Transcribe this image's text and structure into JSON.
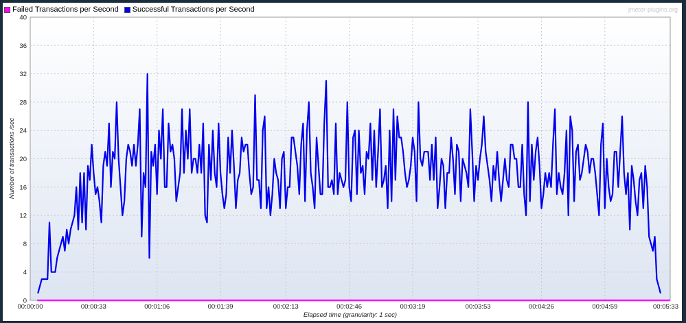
{
  "legend": {
    "failed_label": "Failed Transactions per Second",
    "success_label": "Successful Transactions per Second"
  },
  "watermark": "jmeter-plugins.org",
  "colors": {
    "failed": "#ff00ff",
    "success": "#0000ee",
    "plot_top": "#ffffff",
    "plot_bottom": "#dde5f2",
    "grid": "#c8c8c8"
  },
  "chart_data": {
    "type": "line",
    "title": "",
    "xlabel": "Elapsed time (granularity: 1 sec)",
    "ylabel": "Number of transactions /sec",
    "ylim": [
      0,
      40
    ],
    "xlim_seconds": [
      0,
      333
    ],
    "grid": true,
    "legend_position": "top-left",
    "y_ticks": [
      "0",
      "4",
      "8",
      "12",
      "16",
      "20",
      "24",
      "28",
      "32",
      "36",
      "40"
    ],
    "x_ticks": [
      "00:00:00",
      "00:00:33",
      "00:01:06",
      "00:01:39",
      "00:02:13",
      "00:02:46",
      "00:03:19",
      "00:03:53",
      "00:04:26",
      "00:04:59",
      "00:05:33"
    ],
    "x": [
      "00:00:04",
      "00:00:05",
      "00:00:06",
      "00:00:07",
      "00:00:08",
      "00:00:09",
      "00:00:10",
      "00:00:11",
      "00:00:12",
      "00:00:13",
      "00:00:14",
      "00:00:15",
      "00:00:16",
      "00:00:17",
      "00:00:18",
      "00:00:19",
      "00:00:20",
      "00:00:21",
      "00:00:22",
      "00:00:23",
      "00:00:24",
      "00:00:25",
      "00:00:26",
      "00:00:27",
      "00:00:28",
      "00:00:29",
      "00:00:30",
      "00:00:31",
      "00:00:32",
      "00:00:33",
      "00:00:34",
      "00:00:35",
      "00:00:36",
      "00:00:37",
      "00:00:38",
      "00:00:39",
      "00:00:40",
      "00:00:41",
      "00:00:42",
      "00:00:43",
      "00:00:44",
      "00:00:45",
      "00:00:46",
      "00:00:47",
      "00:00:48",
      "00:00:49",
      "00:00:50",
      "00:00:51",
      "00:00:52",
      "00:00:53",
      "00:00:54",
      "00:00:55",
      "00:00:56",
      "00:00:57",
      "00:00:58",
      "00:00:59",
      "00:01:00",
      "00:01:01",
      "00:01:02",
      "00:01:03",
      "00:01:04",
      "00:01:05",
      "00:01:06",
      "00:01:07",
      "00:01:08",
      "00:01:09",
      "00:01:10",
      "00:01:11",
      "00:01:12",
      "00:01:13",
      "00:01:14",
      "00:01:15",
      "00:01:16",
      "00:01:17",
      "00:01:18",
      "00:01:19",
      "00:01:20",
      "00:01:21",
      "00:01:22",
      "00:01:23",
      "00:01:24",
      "00:01:25",
      "00:01:26",
      "00:01:27",
      "00:01:28",
      "00:01:29",
      "00:01:30",
      "00:01:31",
      "00:01:32",
      "00:01:33",
      "00:01:34",
      "00:01:35",
      "00:01:36",
      "00:01:37",
      "00:01:38",
      "00:01:39",
      "00:01:40",
      "00:01:41",
      "00:01:42",
      "00:01:43",
      "00:01:44",
      "00:01:45",
      "00:01:46",
      "00:01:47",
      "00:01:48",
      "00:01:49",
      "00:01:50",
      "00:01:51",
      "00:01:52",
      "00:01:53",
      "00:01:54",
      "00:01:55",
      "00:01:56",
      "00:01:57",
      "00:01:58",
      "00:01:59",
      "00:02:00",
      "00:02:01",
      "00:02:02",
      "00:02:03",
      "00:02:04",
      "00:02:05",
      "00:02:06",
      "00:02:07",
      "00:02:08",
      "00:02:09",
      "00:02:10",
      "00:02:11",
      "00:02:12",
      "00:02:13",
      "00:02:14",
      "00:02:15",
      "00:02:16",
      "00:02:17",
      "00:02:18",
      "00:02:19",
      "00:02:20",
      "00:02:21",
      "00:02:22",
      "00:02:23",
      "00:02:24",
      "00:02:25",
      "00:02:26",
      "00:02:27",
      "00:02:28",
      "00:02:29",
      "00:02:30",
      "00:02:31",
      "00:02:32",
      "00:02:33",
      "00:02:34",
      "00:02:35",
      "00:02:36",
      "00:02:37",
      "00:02:38",
      "00:02:39",
      "00:02:40",
      "00:02:41",
      "00:02:42",
      "00:02:43",
      "00:02:44",
      "00:02:45",
      "00:02:46",
      "00:02:47",
      "00:02:48",
      "00:02:49",
      "00:02:50",
      "00:02:51",
      "00:02:52",
      "00:02:53",
      "00:02:54",
      "00:02:55",
      "00:02:56",
      "00:02:57",
      "00:02:58",
      "00:02:59",
      "00:03:00",
      "00:03:01",
      "00:03:02",
      "00:03:03",
      "00:03:04",
      "00:03:05",
      "00:03:06",
      "00:03:07",
      "00:03:08",
      "00:03:09",
      "00:03:10",
      "00:03:11",
      "00:03:12",
      "00:03:13",
      "00:03:14",
      "00:03:15",
      "00:03:16",
      "00:03:17",
      "00:03:18",
      "00:03:19",
      "00:03:20",
      "00:03:21",
      "00:03:22",
      "00:03:23",
      "00:03:24",
      "00:03:25",
      "00:03:26",
      "00:03:27",
      "00:03:28",
      "00:03:29",
      "00:03:30",
      "00:03:31",
      "00:03:32",
      "00:03:33",
      "00:03:34",
      "00:03:35",
      "00:03:36",
      "00:03:37",
      "00:03:38",
      "00:03:39",
      "00:03:40",
      "00:03:41",
      "00:03:42",
      "00:03:43",
      "00:03:44",
      "00:03:45",
      "00:03:46",
      "00:03:47",
      "00:03:48",
      "00:03:49",
      "00:03:50",
      "00:03:51",
      "00:03:52",
      "00:03:53",
      "00:03:54",
      "00:03:55",
      "00:03:56",
      "00:03:57",
      "00:03:58",
      "00:03:59",
      "00:04:00",
      "00:04:01",
      "00:04:02",
      "00:04:03",
      "00:04:04",
      "00:04:05",
      "00:04:06",
      "00:04:07",
      "00:04:08",
      "00:04:09",
      "00:04:10",
      "00:04:11",
      "00:04:12",
      "00:04:13",
      "00:04:14",
      "00:04:15",
      "00:04:16",
      "00:04:17",
      "00:04:18",
      "00:04:19",
      "00:04:20",
      "00:04:21",
      "00:04:22",
      "00:04:23",
      "00:04:24",
      "00:04:25",
      "00:04:26",
      "00:04:27",
      "00:04:28",
      "00:04:29",
      "00:04:30",
      "00:04:31",
      "00:04:32",
      "00:04:33",
      "00:04:34",
      "00:04:35",
      "00:04:36",
      "00:04:37",
      "00:04:38",
      "00:04:39",
      "00:04:40",
      "00:04:41",
      "00:04:42",
      "00:04:43",
      "00:04:44",
      "00:04:45",
      "00:04:46",
      "00:04:47",
      "00:04:48",
      "00:04:49",
      "00:04:50",
      "00:04:51",
      "00:04:52",
      "00:04:53",
      "00:04:54",
      "00:04:55",
      "00:04:56",
      "00:04:57",
      "00:04:58",
      "00:04:59",
      "00:05:00",
      "00:05:01",
      "00:05:02",
      "00:05:03",
      "00:05:04",
      "00:05:05",
      "00:05:06",
      "00:05:07",
      "00:05:08",
      "00:05:09",
      "00:05:10",
      "00:05:11",
      "00:05:12",
      "00:05:13",
      "00:05:14",
      "00:05:15",
      "00:05:16",
      "00:05:17",
      "00:05:18",
      "00:05:19",
      "00:05:20",
      "00:05:21",
      "00:05:22",
      "00:05:23",
      "00:05:24",
      "00:05:25",
      "00:05:26",
      "00:05:27",
      "00:05:28",
      "00:05:29",
      "00:05:30",
      "00:05:31",
      "00:05:32",
      "00:05:33"
    ],
    "series": [
      {
        "name": "Successful Transactions per Second",
        "values": [
          1,
          2,
          3,
          3,
          3,
          3,
          11,
          4,
          4,
          4,
          6,
          7,
          8,
          9,
          7,
          10,
          8,
          10,
          11,
          12,
          16,
          10,
          18,
          11,
          18,
          10,
          19,
          17,
          22,
          18,
          15,
          16,
          14,
          11,
          19,
          21,
          19,
          25,
          16,
          21,
          20,
          28,
          20,
          16,
          12,
          14,
          20,
          22,
          21,
          19,
          22,
          19,
          22,
          27,
          9,
          18,
          16,
          32,
          6,
          21,
          19,
          22,
          15,
          24,
          20,
          27,
          16,
          16,
          25,
          21,
          22,
          20,
          14,
          16,
          18,
          27,
          18,
          24,
          20,
          27,
          18,
          20,
          20,
          18,
          22,
          18,
          25,
          12,
          11,
          22,
          17,
          24,
          18,
          16,
          25,
          18,
          15,
          13,
          15,
          23,
          18,
          24,
          19,
          13,
          17,
          18,
          23,
          21,
          22,
          22,
          18,
          15,
          16,
          29,
          17,
          17,
          13,
          24,
          26,
          13,
          16,
          12,
          15,
          20,
          18,
          17,
          13,
          20,
          21,
          13,
          16,
          16,
          23,
          23,
          21,
          19,
          15,
          22,
          25,
          14,
          24,
          28,
          18,
          16,
          13,
          23,
          19,
          15,
          15,
          25,
          31,
          16,
          16,
          17,
          15,
          25,
          15,
          18,
          17,
          16,
          17,
          28,
          16,
          14,
          23,
          24,
          15,
          24,
          18,
          19,
          15,
          21,
          20,
          25,
          17,
          24,
          16,
          21,
          27,
          16,
          17,
          19,
          13,
          24,
          14,
          27,
          17,
          26,
          23,
          23,
          21,
          18,
          16,
          17,
          19,
          23,
          21,
          14,
          28,
          20,
          19,
          21,
          21,
          21,
          17,
          22,
          17,
          23,
          13,
          16,
          20,
          19,
          13,
          18,
          18,
          23,
          20,
          15,
          22,
          21,
          14,
          20,
          19,
          18,
          16,
          27,
          21,
          14,
          19,
          17,
          20,
          22,
          26,
          21,
          19,
          17,
          14,
          19,
          17,
          21,
          17,
          14,
          17,
          20,
          17,
          16,
          22,
          22,
          20,
          20,
          16,
          16,
          22,
          15,
          12,
          28,
          14,
          22,
          17,
          21,
          23,
          19,
          13,
          15,
          18,
          16,
          18,
          16,
          22,
          27,
          15,
          18,
          16,
          15,
          18,
          24,
          12,
          26,
          24,
          14,
          21,
          22,
          17,
          18,
          20,
          22,
          21,
          18,
          20,
          20,
          18,
          15,
          12,
          22,
          25,
          13,
          20,
          16,
          14,
          15,
          21,
          21,
          16,
          21,
          26,
          18,
          15,
          18,
          10,
          19,
          17,
          14,
          12,
          17,
          18,
          13,
          19,
          16,
          9,
          8,
          7,
          9,
          3,
          2,
          1
        ]
      },
      {
        "name": "Failed Transactions per Second",
        "values": [
          0,
          0
        ]
      }
    ]
  }
}
